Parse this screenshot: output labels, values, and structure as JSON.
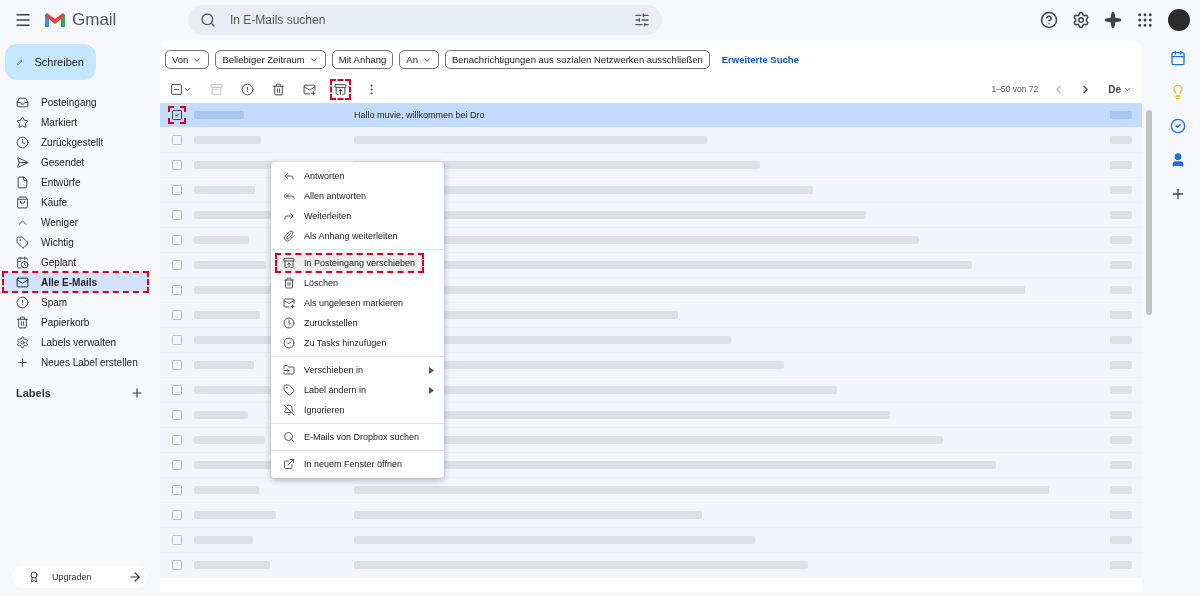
{
  "app": {
    "name": "Gmail"
  },
  "search": {
    "placeholder": "In E-Mails suchen"
  },
  "compose": {
    "label": "Schreiben"
  },
  "sidebar": {
    "items": [
      {
        "label": "Posteingang",
        "selected": false,
        "highlighted": false
      },
      {
        "label": "Markiert",
        "selected": false,
        "highlighted": false
      },
      {
        "label": "Zurückgestellt",
        "selected": false,
        "highlighted": false
      },
      {
        "label": "Gesendet",
        "selected": false,
        "highlighted": false
      },
      {
        "label": "Entwürfe",
        "selected": false,
        "highlighted": false
      },
      {
        "label": "Käufe",
        "selected": false,
        "highlighted": false
      },
      {
        "label": "Weniger",
        "selected": false,
        "highlighted": false
      },
      {
        "label": "Wichtig",
        "selected": false,
        "highlighted": false
      },
      {
        "label": "Geplant",
        "selected": false,
        "highlighted": false
      },
      {
        "label": "Alle E-Mails",
        "selected": true,
        "highlighted": true
      },
      {
        "label": "Spam",
        "selected": false,
        "highlighted": false
      },
      {
        "label": "Papierkorb",
        "selected": false,
        "highlighted": false
      },
      {
        "label": "Labels verwalten",
        "selected": false,
        "highlighted": false
      },
      {
        "label": "Neues Label erstellen",
        "selected": false,
        "highlighted": false
      }
    ],
    "labels_title": "Labels",
    "upgrade": "Upgraden"
  },
  "filters": [
    {
      "label": "Von",
      "dropdown": true
    },
    {
      "label": "Beliebiger Zeitraum",
      "dropdown": true
    },
    {
      "label": "Mit Anhang",
      "dropdown": false
    },
    {
      "label": "An",
      "dropdown": true
    },
    {
      "label": "Benachrichtigungen aus sozialen Netzwerken ausschließen",
      "dropdown": false
    }
  ],
  "advanced_search": "Erweiterte Suche",
  "toolbar": {
    "buttons": [
      {
        "highlighted": false
      },
      {
        "highlighted": false
      },
      {
        "highlighted": false
      },
      {
        "highlighted": false
      },
      {
        "highlighted": false
      },
      {
        "highlighted": true
      },
      {
        "highlighted": false
      }
    ],
    "range": "1–50 von 72",
    "input_tools": "De"
  },
  "rows": [
    {
      "selected": true,
      "checked": true,
      "highlighted": true,
      "subject": "Hallo muvie, willkommen bei Dro"
    },
    {
      "selected": false,
      "checked": false,
      "highlighted": false
    },
    {
      "selected": false,
      "checked": false,
      "highlighted": false
    },
    {
      "selected": false,
      "checked": false,
      "highlighted": false
    },
    {
      "selected": false,
      "checked": false,
      "highlighted": false
    },
    {
      "selected": false,
      "checked": false,
      "highlighted": false
    },
    {
      "selected": false,
      "checked": false,
      "highlighted": false
    },
    {
      "selected": false,
      "checked": false,
      "highlighted": false
    },
    {
      "selected": false,
      "checked": false,
      "highlighted": false
    },
    {
      "selected": false,
      "checked": false,
      "highlighted": false
    },
    {
      "selected": false,
      "checked": false,
      "highlighted": false
    },
    {
      "selected": false,
      "checked": false,
      "highlighted": false
    },
    {
      "selected": false,
      "checked": false,
      "highlighted": false
    },
    {
      "selected": false,
      "checked": false,
      "highlighted": false
    },
    {
      "selected": false,
      "checked": false,
      "highlighted": false
    },
    {
      "selected": false,
      "checked": false,
      "highlighted": false
    },
    {
      "selected": false,
      "checked": false,
      "highlighted": false
    },
    {
      "selected": false,
      "checked": false,
      "highlighted": false
    },
    {
      "selected": false,
      "checked": false,
      "highlighted": false
    }
  ],
  "context_menu": {
    "groups": [
      [
        {
          "label": "Antworten",
          "kind": "item",
          "highlighted": false
        },
        {
          "label": "Allen antworten",
          "kind": "item",
          "highlighted": false
        },
        {
          "label": "Weiterleiten",
          "kind": "item",
          "highlighted": false
        },
        {
          "label": "Als Anhang weiterleiten",
          "kind": "item",
          "highlighted": false
        }
      ],
      [
        {
          "label": "In Posteingang verschieben",
          "kind": "item",
          "highlighted": true
        },
        {
          "label": "Löschen",
          "kind": "item",
          "highlighted": false
        },
        {
          "label": "Als ungelesen markieren",
          "kind": "item",
          "highlighted": false
        },
        {
          "label": "Zurückstellen",
          "kind": "item",
          "highlighted": false
        },
        {
          "label": "Zu Tasks hinzufügen",
          "kind": "item",
          "highlighted": false
        }
      ],
      [
        {
          "label": "Verschieben in",
          "kind": "submenu",
          "highlighted": false
        },
        {
          "label": "Label ändern in",
          "kind": "submenu",
          "highlighted": false
        },
        {
          "label": "Ignorieren",
          "kind": "item",
          "highlighted": false
        }
      ],
      [
        {
          "label": "E-Mails von Dropbox suchen",
          "kind": "item",
          "highlighted": false
        }
      ],
      [
        {
          "label": "In neuem Fenster öffnen",
          "kind": "item",
          "highlighted": false
        }
      ]
    ]
  }
}
